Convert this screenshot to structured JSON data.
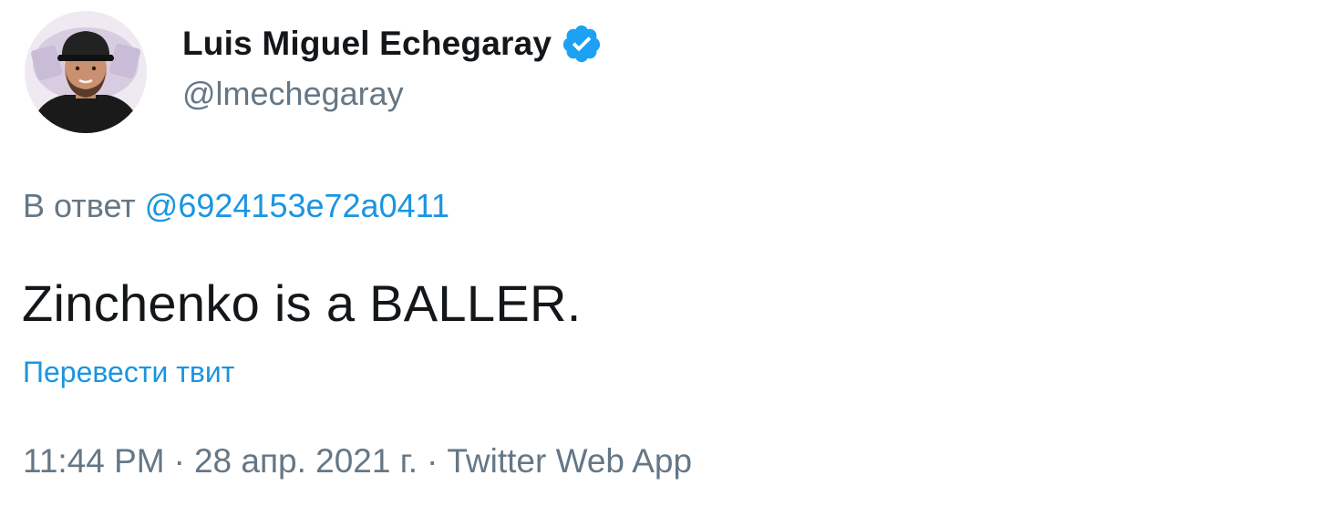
{
  "author": {
    "display_name": "Luis Miguel Echegaray",
    "handle": "@lmechegaray",
    "verified": true,
    "avatar": "profile-photo"
  },
  "reply": {
    "prefix": "В ответ",
    "to_handle": "@6924153e72a0411"
  },
  "tweet": {
    "text": "Zinchenko is a BALLER.",
    "translate_label": "Перевести твит"
  },
  "meta": {
    "time": "11:44 PM",
    "separator": "·",
    "date": "28 апр. 2021 г.",
    "source": "Twitter Web App"
  },
  "colors": {
    "link": "#1b95e0",
    "secondary_text": "#657786",
    "primary_text": "#14171a",
    "verified_badge": "#1da1f2"
  },
  "icons": {
    "verified": "verified-badge-icon"
  }
}
